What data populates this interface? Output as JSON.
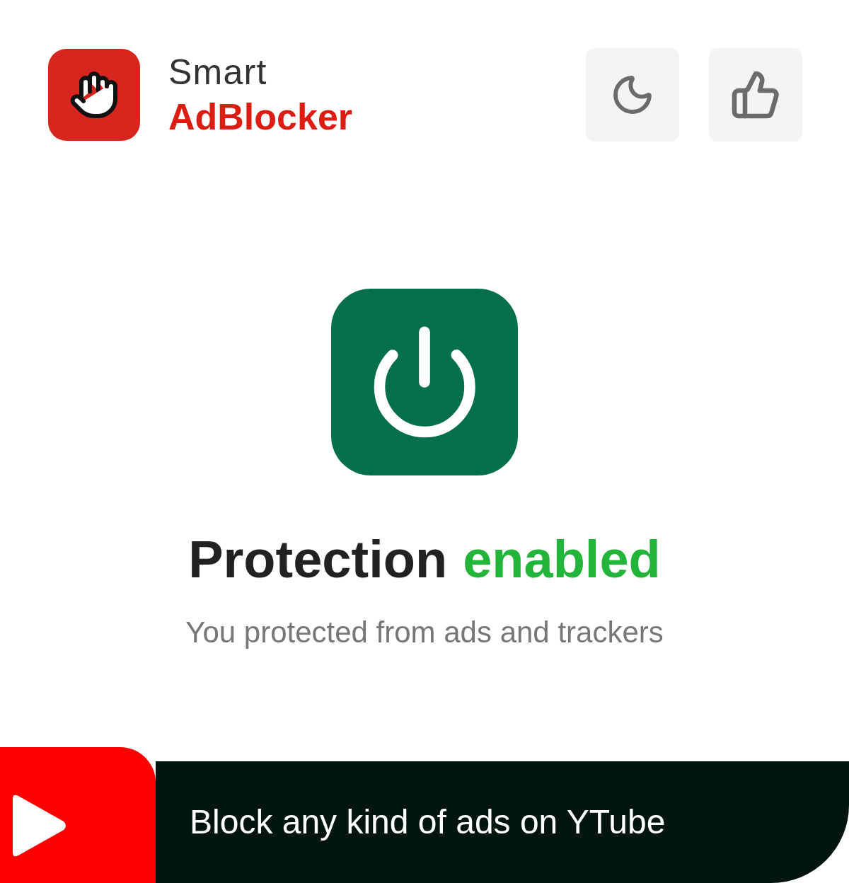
{
  "header": {
    "brand_top": "Smart",
    "brand_bottom": "AdBlocker",
    "buttons": [
      {
        "kind": "theme"
      },
      {
        "kind": "rate"
      }
    ]
  },
  "protection": {
    "on": true,
    "title": "Protection",
    "state": "enabled",
    "subtitle": "You protected from ads and trackers"
  },
  "banner": {
    "text": "Block any kind of ads on YTube"
  }
}
